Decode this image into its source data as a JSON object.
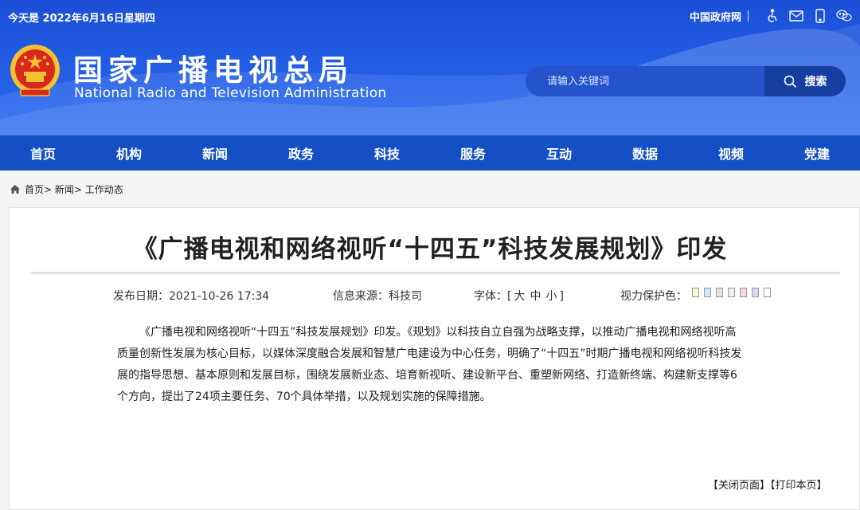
{
  "topbar": {
    "date": "今天是 2022年6月16日星期四",
    "gov_link": "中国政府网",
    "icons": [
      "accessibility-icon",
      "mail-icon",
      "mobile-icon",
      "wechat-icon"
    ]
  },
  "header": {
    "title_cn": "国家广播电视总局",
    "title_en": "National Radio and Television Administration",
    "logo": "national-emblem"
  },
  "search": {
    "placeholder": "请输入关键词",
    "button_label": "搜索"
  },
  "nav": {
    "items": [
      "首页",
      "机构",
      "新闻",
      "政务",
      "科技",
      "服务",
      "互动",
      "数据",
      "视频",
      "党建"
    ]
  },
  "breadcrumb": {
    "items": [
      "首页>",
      "新闻>",
      "工作动态"
    ]
  },
  "article": {
    "title": "《广播电视和网络视听“十四五”科技发展规划》印发",
    "publish_label": "发布日期：2021-10-26 17:34",
    "source_label": "信息来源：科技司",
    "font_size": {
      "prefix": "字体：[",
      "large": "大",
      "medium": "中",
      "small": "小",
      "suffix": "]"
    },
    "eye_care_label": "视力保护色：",
    "eye_care_colors": [
      "#fafac8",
      "#cfe8f5",
      "#e6e6e6",
      "#f0f0f0",
      "#f6d6e0",
      "#e2d4f0",
      "#ffffff"
    ],
    "body": "《广播电视和网络视听“十四五”科技发展规划》印发。《规划》以科技自立自强为战略支撑，以推动广播电视和网络视听高质量创新性发展为核心目标，以媒体深度融合发展和智慧广电建设为中心任务，明确了“十四五”时期广播电视和网络视听科技发展的指导思想、基本原则和发展目标，围绕发展新业态、培育新视听、建设新平台、重塑新网络、打造新终端、构建新支撑等6个方向，提出了24项主要任务、70个具体举措，以及规划实施的保障措施。"
  },
  "actions": {
    "close": "【关闭页面】",
    "print": "【打印本页】"
  },
  "colors": {
    "header_blue": "#2463e6",
    "nav_blue": "#1450c4",
    "search_button": "#173f9f"
  }
}
